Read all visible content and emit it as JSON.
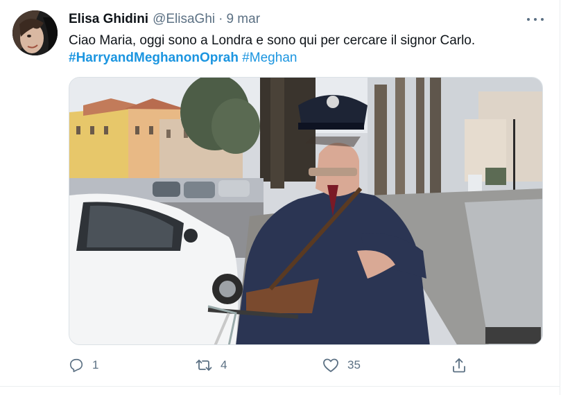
{
  "tweet": {
    "author": {
      "name": "Elisa Ghidini",
      "handle": "@ElisaGhi",
      "separator": "·",
      "date": "9 mar"
    },
    "text": "Ciao Maria, oggi sono a Londra e sono qui per cercare il signor Carlo.",
    "hashtags": [
      "#HarryandMeghanonOprah",
      "#Meghan"
    ],
    "media": {
      "description_icon": "photo"
    },
    "actions": {
      "reply_count": "1",
      "retweet_count": "4",
      "like_count": "35"
    }
  },
  "colors": {
    "link": "#1b95e0",
    "secondary_text": "#5b7083",
    "primary_text": "#0f1419",
    "border": "#ebeef0"
  },
  "icons": [
    "avatar",
    "more-icon",
    "reply-icon",
    "retweet-icon",
    "like-icon",
    "share-icon"
  ]
}
